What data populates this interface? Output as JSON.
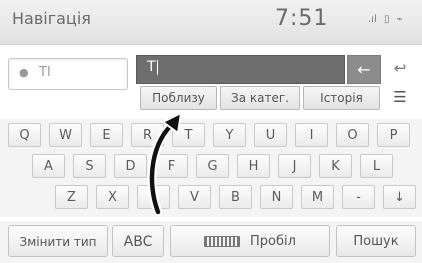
{
  "header": {
    "title": "Навігація",
    "time": "7:51",
    "status_icons": [
      "signal-icon",
      "phone-icon",
      "bluetooth-icon"
    ]
  },
  "destination": {
    "pin_icon": "location-pin-icon",
    "text": "TI"
  },
  "search": {
    "value": "T",
    "backspace_icon": "arrow-left-icon",
    "return_icon": "return-icon"
  },
  "tabs": [
    {
      "label": "Поблизу"
    },
    {
      "label": "За катег."
    },
    {
      "label": "Історія"
    }
  ],
  "list_icon": "list-icon",
  "keyboard": {
    "row1": [
      "Q",
      "W",
      "E",
      "R",
      "T",
      "Y",
      "U",
      "I",
      "O",
      "P"
    ],
    "row2": [
      "A",
      "S",
      "D",
      "F",
      "G",
      "H",
      "J",
      "K",
      "L"
    ],
    "row3": [
      "Z",
      "X",
      "C",
      "V",
      "B",
      "N",
      "M",
      "-",
      "↓"
    ]
  },
  "bottom": {
    "change_type": "Змінити тип",
    "abc": "ABC",
    "space": "Пробіл",
    "search": "Пошук"
  }
}
